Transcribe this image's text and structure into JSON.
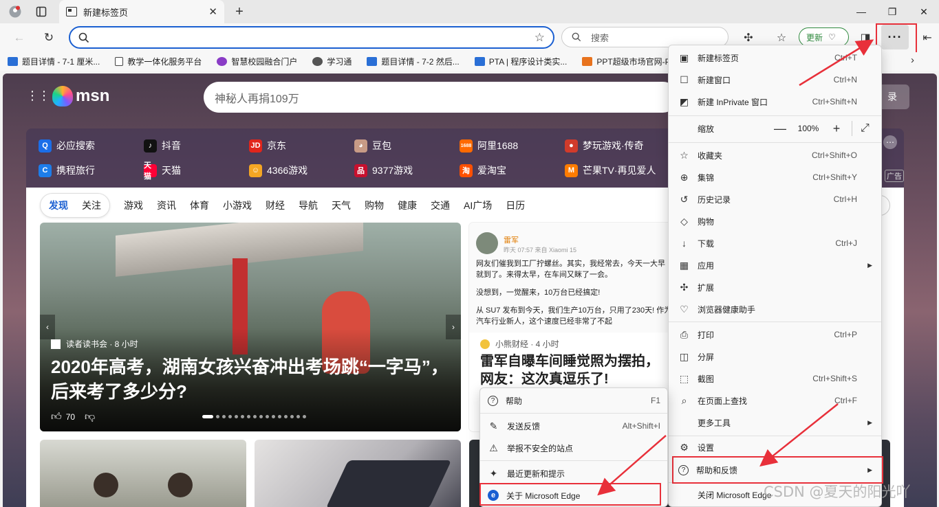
{
  "browser": {
    "tab_title": "新建标签页",
    "address_value": "",
    "side_search_placeholder": "搜索",
    "update_label": "更新"
  },
  "favorites": [
    {
      "label": "题目详情 - 7-1 厘米...",
      "color": "#2a6fd6"
    },
    {
      "label": "教学一体化服务平台",
      "color": "#888888"
    },
    {
      "label": "智慧校园融合门户",
      "color": "#8a3cc6"
    },
    {
      "label": "学习通",
      "color": "#555555"
    },
    {
      "label": "题目详情 - 7-2 然后...",
      "color": "#2a6fd6"
    },
    {
      "label": "PTA | 程序设计类实...",
      "color": "#2a6fd6"
    },
    {
      "label": "PPT超级市场官网-P...",
      "color": "#e8731e"
    }
  ],
  "msn": {
    "logo_text": "msn",
    "search_placeholder": "神秘人再捐109万",
    "login_label": "录"
  },
  "quick_links": [
    {
      "label": "必应搜索",
      "color": "#1b6ee8",
      "glyph": "Q"
    },
    {
      "label": "抖音",
      "color": "#111111",
      "glyph": "♪"
    },
    {
      "label": "京东",
      "color": "#e1251b",
      "glyph": "JD"
    },
    {
      "label": "豆包",
      "color": "#c89b86",
      "glyph": "◕"
    },
    {
      "label": "阿里1688",
      "color": "#ff6a00",
      "glyph": "1688"
    },
    {
      "label": "梦玩游戏·传奇",
      "color": "#d13b2b",
      "glyph": "●"
    },
    {
      "label": "携程旅行",
      "color": "#1d7dea",
      "glyph": "C"
    },
    {
      "label": "天猫",
      "color": "#ff0036",
      "glyph": "天猫"
    },
    {
      "label": "4366游戏",
      "color": "#f5a623",
      "glyph": "☺"
    },
    {
      "label": "9377游戏",
      "color": "#c8102e",
      "glyph": "品"
    },
    {
      "label": "爱淘宝",
      "color": "#ff5000",
      "glyph": "淘"
    },
    {
      "label": "芒果TV·再见爱人",
      "color": "#ff7c00",
      "glyph": "M"
    }
  ],
  "quick_more": "⋯",
  "ad_badge": "广告",
  "feed_nav": {
    "pill": [
      "发现",
      "关注"
    ],
    "items": [
      "游戏",
      "资讯",
      "体育",
      "小游戏",
      "财经",
      "导航",
      "天气",
      "购物",
      "健康",
      "交通",
      "AI广场",
      "日历"
    ]
  },
  "hero": {
    "source": "读者读书会 · 8 小时",
    "title": "2020年高考，湖南女孩兴奋冲出考场跳“一字马”，后来考了多少分?",
    "likes": "70"
  },
  "post": {
    "author": "雷军",
    "meta": "昨天 07:57  来自 Xiaomi 15",
    "body": [
      "网友们催我到工厂拧螺丝。其实，我经常去，今天一大早就到了。来得太早，在车间又眯了一会。",
      "没想到，一觉醒来，10万台已经搞定!",
      "从 SU7 发布到今天，我们生产10万台，只用了230天! 作为汽车行业新人，这个速度已经非常了不起"
    ],
    "source": "小熊财经 · 4 小时",
    "title": "雷军自曝车间睡觉照为摆拍，网友：这次真逗乐了!"
  },
  "main_menu": {
    "items": [
      {
        "label": "新建标签页",
        "shortcut": "Ctrl+T",
        "icon": "new-tab-icon",
        "glyph": "▣"
      },
      {
        "label": "新建窗口",
        "shortcut": "Ctrl+N",
        "icon": "new-window-icon",
        "glyph": "☐"
      },
      {
        "label": "新建 InPrivate 窗口",
        "shortcut": "Ctrl+Shift+N",
        "icon": "inprivate-icon",
        "glyph": "◩"
      }
    ],
    "zoom": {
      "label": "缩放",
      "value": "100%",
      "minus": "—",
      "plus": "+",
      "expand": "⤢"
    },
    "items2": [
      {
        "label": "收藏夹",
        "shortcut": "Ctrl+Shift+O",
        "icon": "favorites-icon",
        "glyph": "☆"
      },
      {
        "label": "集锦",
        "shortcut": "Ctrl+Shift+Y",
        "icon": "collections-icon",
        "glyph": "⊕"
      },
      {
        "label": "历史记录",
        "shortcut": "Ctrl+H",
        "icon": "history-icon",
        "glyph": "↺"
      },
      {
        "label": "购物",
        "shortcut": "",
        "icon": "shopping-icon",
        "glyph": "◇"
      },
      {
        "label": "下载",
        "shortcut": "Ctrl+J",
        "icon": "download-icon",
        "glyph": "↓"
      },
      {
        "label": "应用",
        "shortcut": "",
        "icon": "apps-icon",
        "glyph": "▦"
      },
      {
        "label": "扩展",
        "shortcut": "",
        "icon": "extensions-icon",
        "glyph": "✣"
      },
      {
        "label": "浏览器健康助手",
        "shortcut": "",
        "icon": "health-icon",
        "glyph": "♡"
      }
    ],
    "items3": [
      {
        "label": "打印",
        "shortcut": "Ctrl+P",
        "icon": "print-icon",
        "glyph": "⎙"
      },
      {
        "label": "分屏",
        "shortcut": "",
        "icon": "split-screen-icon",
        "glyph": "◫"
      },
      {
        "label": "截图",
        "shortcut": "Ctrl+Shift+S",
        "icon": "screenshot-icon",
        "glyph": "⬚"
      },
      {
        "label": "在页面上查找",
        "shortcut": "Ctrl+F",
        "icon": "find-icon",
        "glyph": "⌕"
      },
      {
        "label": "更多工具",
        "shortcut": "",
        "icon": "more-tools-icon",
        "glyph": ""
      }
    ],
    "items4": [
      {
        "label": "设置",
        "shortcut": "",
        "icon": "settings-icon",
        "glyph": "⚙"
      },
      {
        "label": "帮助和反馈",
        "shortcut": "",
        "icon": "help-icon",
        "glyph": "?"
      },
      {
        "label": "关闭 Microsoft Edge",
        "shortcut": "",
        "icon": "close-edge-icon",
        "glyph": ""
      }
    ]
  },
  "help_menu": {
    "items": [
      {
        "label": "帮助",
        "shortcut": "F1",
        "icon": "help-circle-icon",
        "glyph": "?"
      },
      {
        "label": "发送反馈",
        "shortcut": "Alt+Shift+I",
        "icon": "feedback-icon",
        "glyph": "✎"
      },
      {
        "label": "举报不安全的站点",
        "shortcut": "",
        "icon": "warning-icon",
        "glyph": "⚠"
      },
      {
        "label": "最近更新和提示",
        "shortcut": "",
        "icon": "whats-new-icon",
        "glyph": "✦"
      },
      {
        "label": "关于 Microsoft Edge",
        "shortcut": "",
        "icon": "edge-logo-icon",
        "glyph": "e"
      }
    ]
  },
  "watermark": "CSDN @夏天的阳光吖",
  "colors": {
    "accent": "#1a5fd1",
    "highlight": "#e8303a",
    "update_green": "#2f8a3e"
  }
}
